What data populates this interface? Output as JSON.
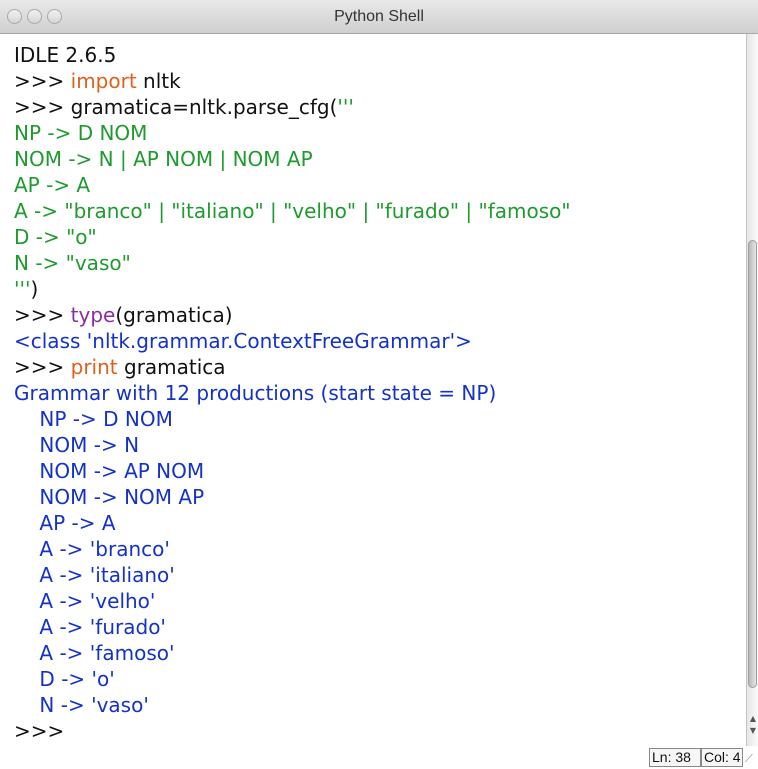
{
  "window": {
    "title": "Python Shell"
  },
  "shell": {
    "banner": "IDLE 2.6.5",
    "lines": [
      {
        "segments": [
          {
            "text": ">>> ",
            "color": "black"
          },
          {
            "text": "import",
            "color": "orange"
          },
          {
            "text": " nltk",
            "color": "black"
          }
        ]
      },
      {
        "segments": [
          {
            "text": ">>> gramatica=nltk.parse_cfg(",
            "color": "black"
          },
          {
            "text": "'''",
            "color": "green"
          }
        ]
      },
      {
        "segments": [
          {
            "text": "NP -> D NOM",
            "color": "green"
          }
        ]
      },
      {
        "segments": [
          {
            "text": "NOM -> N | AP NOM | NOM AP",
            "color": "green"
          }
        ]
      },
      {
        "segments": [
          {
            "text": "AP -> A",
            "color": "green"
          }
        ]
      },
      {
        "segments": [
          {
            "text": "A -> \"branco\" | \"italiano\" | \"velho\" | \"furado\" | \"famoso\"",
            "color": "green"
          }
        ]
      },
      {
        "segments": [
          {
            "text": "D -> \"o\"",
            "color": "green"
          }
        ]
      },
      {
        "segments": [
          {
            "text": "N -> \"vaso\"",
            "color": "green"
          }
        ]
      },
      {
        "segments": [
          {
            "text": "'''",
            "color": "green"
          },
          {
            "text": ")",
            "color": "black"
          }
        ]
      },
      {
        "segments": [
          {
            "text": ">>> ",
            "color": "black"
          },
          {
            "text": "type",
            "color": "purple"
          },
          {
            "text": "(gramatica)",
            "color": "black"
          }
        ]
      },
      {
        "segments": [
          {
            "text": "<class 'nltk.grammar.ContextFreeGrammar'>",
            "color": "blue"
          }
        ]
      },
      {
        "segments": [
          {
            "text": ">>> ",
            "color": "black"
          },
          {
            "text": "print",
            "color": "orange"
          },
          {
            "text": " gramatica",
            "color": "black"
          }
        ]
      },
      {
        "segments": [
          {
            "text": "Grammar with 12 productions (start state = NP)",
            "color": "blue"
          }
        ]
      },
      {
        "segments": [
          {
            "text": "    NP -> D NOM",
            "color": "blue"
          }
        ]
      },
      {
        "segments": [
          {
            "text": "    NOM -> N",
            "color": "blue"
          }
        ]
      },
      {
        "segments": [
          {
            "text": "    NOM -> AP NOM",
            "color": "blue"
          }
        ]
      },
      {
        "segments": [
          {
            "text": "    NOM -> NOM AP",
            "color": "blue"
          }
        ]
      },
      {
        "segments": [
          {
            "text": "    AP -> A",
            "color": "blue"
          }
        ]
      },
      {
        "segments": [
          {
            "text": "    A -> 'branco'",
            "color": "blue"
          }
        ]
      },
      {
        "segments": [
          {
            "text": "    A -> 'italiano'",
            "color": "blue"
          }
        ]
      },
      {
        "segments": [
          {
            "text": "    A -> 'velho'",
            "color": "blue"
          }
        ]
      },
      {
        "segments": [
          {
            "text": "    A -> 'furado'",
            "color": "blue"
          }
        ]
      },
      {
        "segments": [
          {
            "text": "    A -> 'famoso'",
            "color": "blue"
          }
        ]
      },
      {
        "segments": [
          {
            "text": "    D -> 'o'",
            "color": "blue"
          }
        ]
      },
      {
        "segments": [
          {
            "text": "    N -> 'vaso'",
            "color": "blue"
          }
        ]
      },
      {
        "segments": [
          {
            "text": ">>> ",
            "color": "black"
          }
        ]
      }
    ]
  },
  "status": {
    "line": "Ln: 38",
    "column": "Col: 4"
  },
  "colors": {
    "black": "#111111",
    "green": "#1f9b2e",
    "orange": "#e0601b",
    "purple": "#8a2ea6",
    "blue": "#1432c8"
  },
  "icons": {
    "close": "close-button-icon",
    "minimize": "minimize-button-icon",
    "zoom": "zoom-button-icon",
    "scroll_up": "scroll-up-arrow-icon",
    "scroll_down": "scroll-down-arrow-icon",
    "resize": "resize-grip-icon"
  }
}
